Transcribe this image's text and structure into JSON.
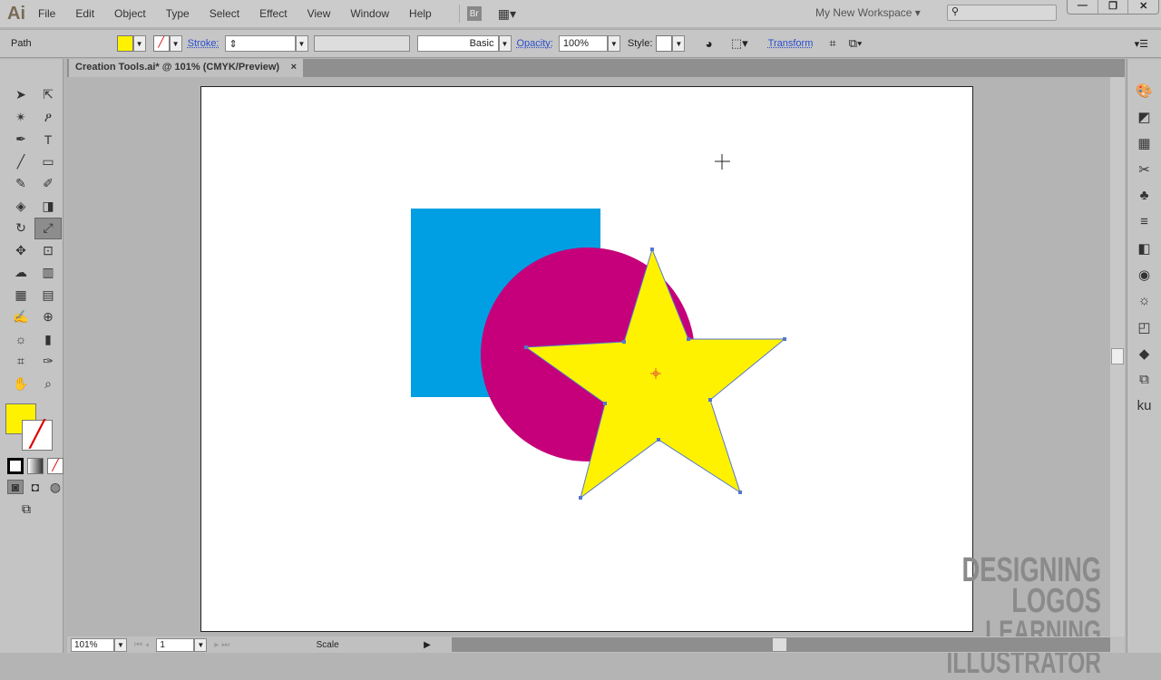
{
  "app": {
    "logo": "Ai",
    "menus": [
      "File",
      "Edit",
      "Object",
      "Type",
      "Select",
      "Effect",
      "View",
      "Window",
      "Help"
    ],
    "bridge": "Br",
    "workspace": "My New Workspace ▾",
    "window_controls": [
      "—",
      "❐",
      "✕"
    ]
  },
  "control": {
    "selection": "Path",
    "fill_color": "#fff200",
    "stroke_label": "Stroke:",
    "brush": "Basic",
    "opacity_label": "Opacity:",
    "opacity": "100%",
    "style_label": "Style:",
    "transform_label": "Transform"
  },
  "document": {
    "tab": "Creation Tools.ai* @ 101% (CMYK/Preview)",
    "close": "×"
  },
  "tools": [
    "➤",
    "⇱",
    "✴",
    "ዖ",
    "✒",
    "T",
    "╱",
    "▭",
    "✎",
    "✐",
    "◈",
    "◨",
    "↻",
    "⤢",
    "✥",
    "⊡",
    "☁",
    "▥",
    "▦",
    "▤",
    "✍",
    "⊕",
    "☼",
    "▮",
    "⌗",
    "✑",
    "✋",
    "⌕"
  ],
  "dock_icons": [
    "🎨",
    "◩",
    "▦",
    "✂",
    "♣",
    "≡",
    "◧",
    "◉",
    "☼",
    "◰",
    "◆",
    "⧉",
    "ku"
  ],
  "status": {
    "zoom": "101%",
    "page": "1",
    "tool": "Scale"
  },
  "watermark": {
    "line1": "DESIGNING LOGOS",
    "line2": "LEARNING ILLUSTRATOR"
  },
  "colors": {
    "square": "#009fe3",
    "circle": "#c5007a",
    "star": "#fff200"
  }
}
